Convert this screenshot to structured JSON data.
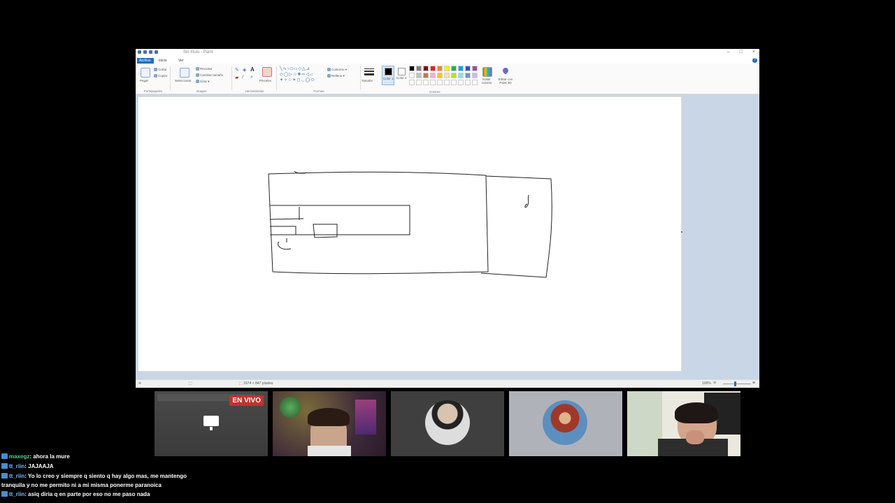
{
  "paint": {
    "title": "Sin título - Paint",
    "menu": {
      "file": "Archivo",
      "home": "Inicio",
      "view": "Ver"
    },
    "ribbon": {
      "clipboard": {
        "paste": "Pegar",
        "cut": "Cortar",
        "copy": "Copiar",
        "label": "Portapapeles"
      },
      "image": {
        "select": "Seleccionar",
        "crop": "Recortar",
        "resize": "Cambiar tamaño",
        "rotate": "Girar",
        "label": "Imagen"
      },
      "tools": {
        "brushes": "Pinceles",
        "label": "Herramientas"
      },
      "shapes": {
        "outline": "Contorno",
        "fill": "Relleno",
        "label": "Formas"
      },
      "size": "Tamaño",
      "color1": "Color 1",
      "color2": "Color 2",
      "colors": {
        "edit": "Editar colores",
        "paint3d": "Editar con Paint 3D",
        "label": "Colores"
      }
    },
    "palette_row1": [
      "#000000",
      "#7f7f7f",
      "#880015",
      "#ed1c24",
      "#ff7f27",
      "#fff200",
      "#22b14c",
      "#00a2e8",
      "#3f48cc",
      "#a349a4"
    ],
    "palette_row2": [
      "#ffffff",
      "#c3c3c3",
      "#b97a57",
      "#ffaec9",
      "#ffc90e",
      "#efe4b0",
      "#b5e61d",
      "#99d9ea",
      "#7092be",
      "#c8bfe7"
    ],
    "status": {
      "dimensions": "1674 × 847 píxeles",
      "zoom": "100%"
    }
  },
  "tiles": {
    "live_label": "EN VIVO"
  },
  "chat": [
    {
      "user": "maxegz",
      "text": ": ahora la mure"
    },
    {
      "user": "tt_riin",
      "text": ": JAJAAJA"
    },
    {
      "user": "tt_riin",
      "text": ": Yo lo creo y siempre q siento q hay algo mas, me mantengo",
      "continuation": "tranquila y no me permito ni a mi misma ponerme paranoica"
    },
    {
      "user": "tt_riin",
      "text": ": asiq diria q en parte por eso no me paso nada"
    }
  ]
}
